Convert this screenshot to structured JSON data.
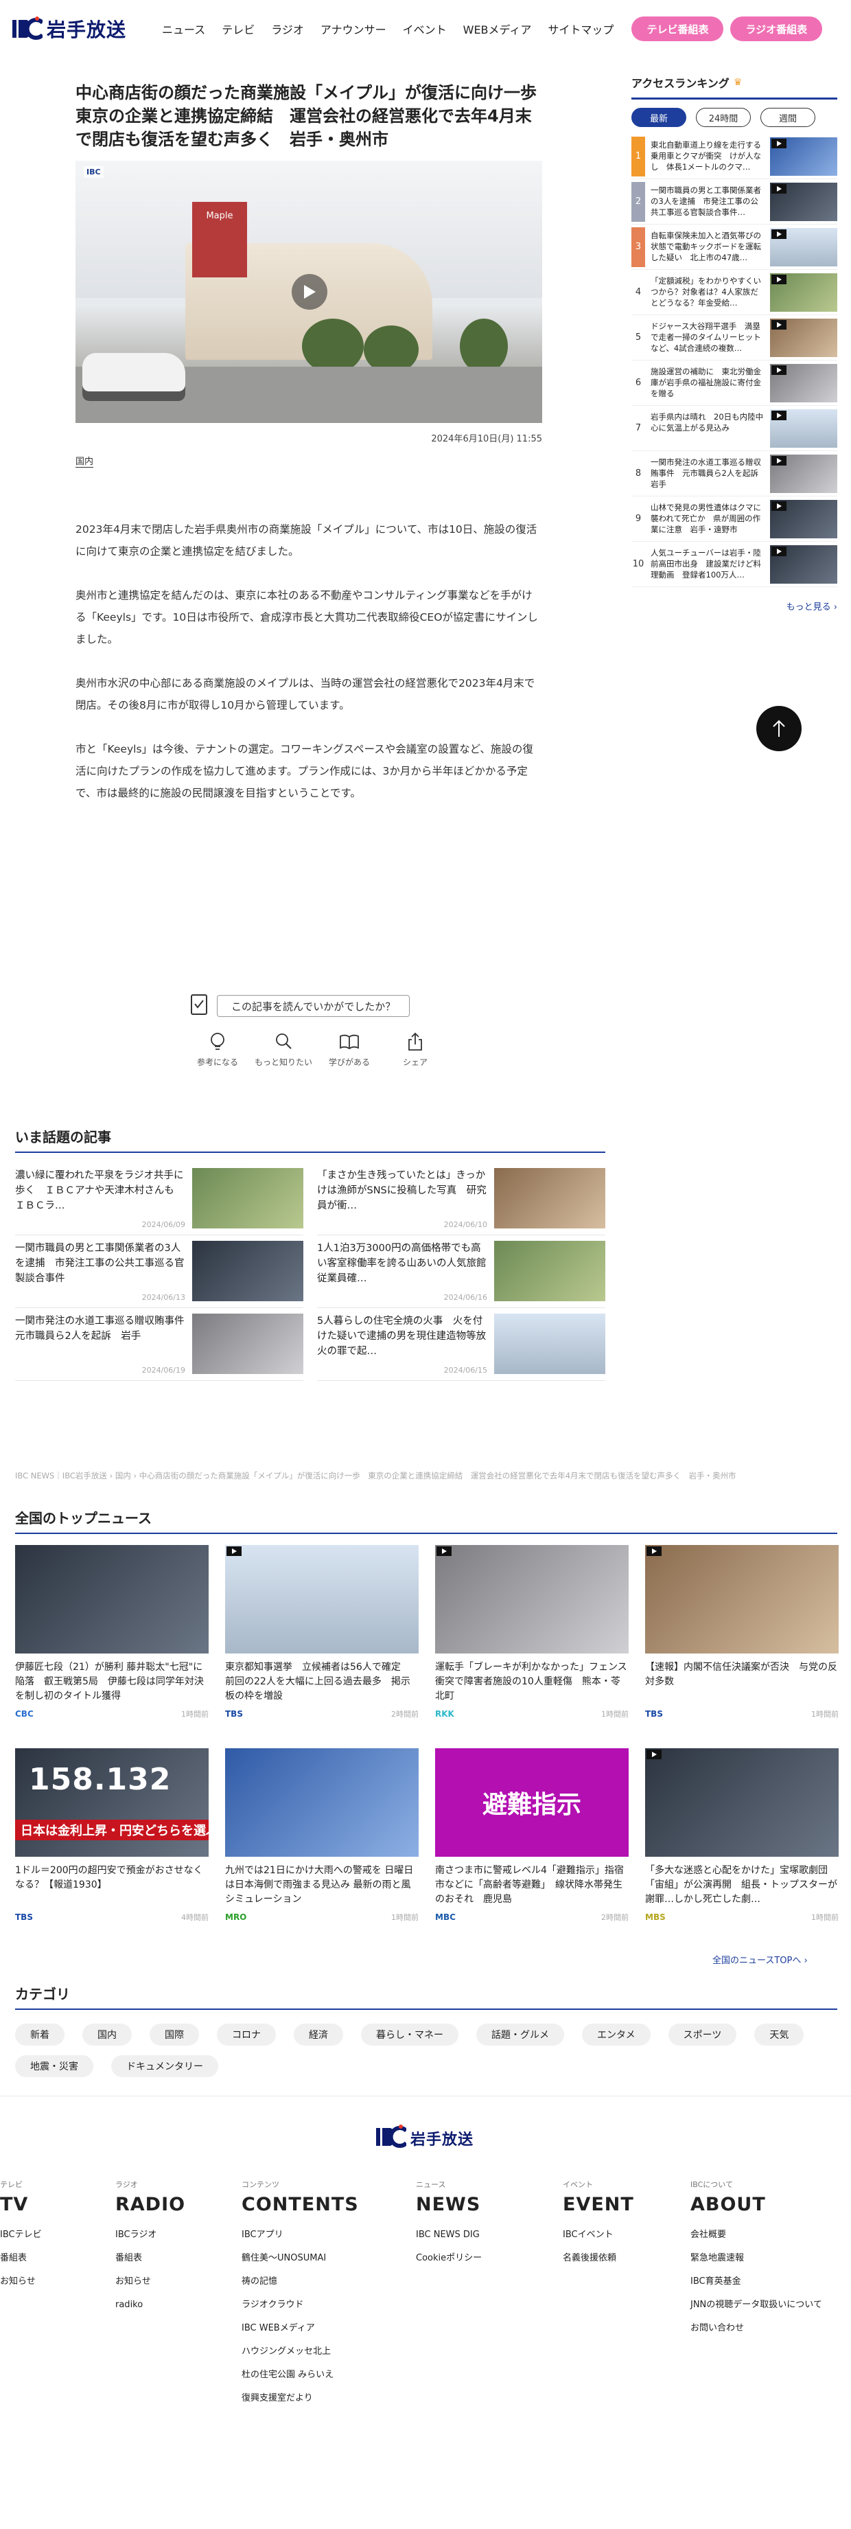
{
  "header": {
    "logo_text": "岩手放送",
    "nav": [
      "ニュース",
      "テレビ",
      "ラジオ",
      "アナウンサー",
      "イベント",
      "WEBメディア",
      "サイトマップ"
    ],
    "tv_schedule": "テレビ番組表",
    "radio_schedule": "ラジオ番組表"
  },
  "article": {
    "title": "中心商店街の顔だった商業施設「メイプル」が復活に向け一歩　東京の企業と連携協定締結　運営会社の経営悪化で去年4月末で閉店も復活を望む声多く　岩手・奥州市",
    "video_logo": "IBC",
    "video_sign": "Maple",
    "date": "2024年6月10日(月) 11:55",
    "category": "国内",
    "paragraphs": [
      "2023年4月末で閉店した岩手県奥州市の商業施設「メイプル」について、市は10日、施設の復活に向けて東京の企業と連携協定を結びました。",
      "奥州市と連携協定を結んだのは、東京に本社のある不動産やコンサルティング事業などを手がける「Keeyls」です。10日は市役所で、倉成淳市長と大貫功二代表取締役CEOが協定書にサインしました。",
      "奥州市水沢の中心部にある商業施設のメイプルは、当時の運営会社の経営悪化で2023年4月末で閉店。その後8月に市が取得し10月から管理しています。",
      "市と「Keeyls」は今後、テナントの選定。コワーキングスペースや会議室の設置など、施設の復活に向けたプランの作成を協力して進めます。プラン作成には、3か月から半年ほどかかる予定で、市は最終的に施設の民間譲渡を目指すということです。"
    ]
  },
  "feedback": {
    "question": "この記事を読んでいかがでしたか？",
    "reactions": [
      "参考になる",
      "もっと知りたい",
      "学びがある",
      "シェア"
    ]
  },
  "sidebar": {
    "title": "アクセスランキング",
    "tabs": [
      "最新",
      "24時間",
      "週間"
    ],
    "ranking": [
      {
        "rank": "1",
        "text": "東北自動車道上り線を走行する乗用車とクマが衝突　けが人なし　体長1メートルのクマ…"
      },
      {
        "rank": "2",
        "text": "一関市職員の男と工事関係業者の3人を逮捕　市発注工事の公共工事巡る官製談合事件…"
      },
      {
        "rank": "3",
        "text": "自転車保険未加入と酒気帯びの状態で電動キックボードを運転した疑い　北上市の47歳…"
      },
      {
        "rank": "4",
        "text": "「定額減税」をわかりやすくいつから？対象者は？4人家族だとどうなる？年金受給…"
      },
      {
        "rank": "5",
        "text": "ドジャース大谷翔平選手　満塁で走者一掃のタイムリーヒットなど、4試合連続の複数…"
      },
      {
        "rank": "6",
        "text": "施設運営の補助に　東北労働金庫が岩手県の福祉施設に寄付金を贈る"
      },
      {
        "rank": "7",
        "text": "岩手県内は晴れ　20日も内陸中心に気温上がる見込み"
      },
      {
        "rank": "8",
        "text": "一関市発注の水道工事巡る贈収賄事件　元市職員ら2人を起訴　岩手"
      },
      {
        "rank": "9",
        "text": "山林で発見の男性遺体はクマに襲われて死亡か　県が周囲の作業に注意　岩手・遠野市"
      },
      {
        "rank": "10",
        "text": "人気ユーチューバーは岩手・陸前高田市出身　建設業だけど料理動画　登録者100万人…"
      }
    ],
    "more": "もっと見る ›"
  },
  "hot": {
    "title": "いま話題の記事",
    "items": [
      {
        "title": "濃い緑に覆われた平泉をラジオ共手に歩く　ＩＢＣアナや天津木村さんも　ＩＢＣラ…",
        "date": "2024/06/09"
      },
      {
        "title": "「まさか生き残っていたとは」きっかけは漁師がSNSに投稿した写真　研究員が衝…",
        "date": "2024/06/10"
      },
      {
        "title": "一関市職員の男と工事関係業者の3人を逮捕　市発注工事の公共工事巡る官製談合事件",
        "date": "2024/06/13"
      },
      {
        "title": "1人1泊3万3000円の高価格帯でも高い客室稼働率を誇る山あいの人気旅館　従業員確…",
        "date": "2024/06/16"
      },
      {
        "title": "一関市発注の水道工事巡る贈収賄事件　元市職員ら2人を起訴　岩手",
        "date": "2024/06/19"
      },
      {
        "title": "5人暮らしの住宅全焼の火事　火を付けた疑いで逮捕の男を現住建造物等放火の罪で起…",
        "date": "2024/06/15"
      }
    ]
  },
  "breadcrumb": "IBC NEWS｜IBC岩手放送 › 国内 › 中心商店街の顔だった商業施設「メイプル」が復活に向け一歩　東京の企業と連携協定締結　運営会社の経営悪化で去年4月末で閉店も復活を望む声多く　岩手・奥州市",
  "topnews": {
    "title": "全国のトップニュース",
    "items": [
      {
        "title": "伊藤匠七段（21）が勝利 藤井聡太\"七冠\"に陥落　叡王戦第5局　伊藤七段は同学年対決を制し初のタイトル獲得",
        "source": "CBC",
        "time": "1時間前",
        "src_color": "#2a6fd1"
      },
      {
        "title": "東京都知事選挙　立候補者は56人で確定　前回の22人を大幅に上回る過去最多　掲示板の枠を増設",
        "source": "TBS",
        "time": "2時間前",
        "src_color": "#1a4aa6"
      },
      {
        "title": "運転手「ブレーキが利かなかった」フェンス衝突で障害者施設の10人重軽傷　熊本・苓北町",
        "source": "RKK",
        "time": "1時間前",
        "src_color": "#2db8c9"
      },
      {
        "title": "【速報】内閣不信任決議案が否決　与党の反対多数",
        "source": "TBS",
        "time": "1時間前",
        "src_color": "#1a4aa6"
      },
      {
        "title": "1ドル＝200円の超円安で預金がおさせなくなる？【報道1930】",
        "source": "TBS",
        "time": "4時間前",
        "src_color": "#1a4aa6"
      },
      {
        "title": "九州では21日にかけ大雨への警戒を 日曜日は日本海側で雨強まる見込み 最新の雨と風シミュレーション",
        "source": "MRO",
        "time": "1時間前",
        "src_color": "#2ba02b"
      },
      {
        "title": "南さつま市に警戒レベル4「避難指示」指宿市などに「高齢者等避難」　線状降水帯発生のおそれ　鹿児島",
        "source": "MBC",
        "time": "2時間前",
        "src_color": "#1b5aa9"
      },
      {
        "title": "「多大な迷惑と心配をかけた」宝塚歌劇団「宙組」が公演再開　組長・トップスターが謝罪…しかし死亡した劇…",
        "source": "MBS",
        "time": "1時間前",
        "src_color": "#b5a51e"
      }
    ],
    "price_text": "158.132",
    "strip_text": "日本は金利上昇・円安どちらを選ぶのか",
    "evac_text": "避難指示",
    "more": "全国のニュースTOPへ ›"
  },
  "category": {
    "title": "カテゴリ",
    "items": [
      "新着",
      "国内",
      "国際",
      "コロナ",
      "経済",
      "暮らし・マネー",
      "話題・グルメ",
      "エンタメ",
      "スポーツ",
      "天気",
      "地震・災害",
      "ドキュメンタリー"
    ]
  },
  "footer": {
    "logo_text": "岩手放送",
    "cols": [
      {
        "small": "テレビ",
        "head": "TV",
        "links": [
          "IBCテレビ",
          "番組表",
          "お知らせ"
        ]
      },
      {
        "small": "ラジオ",
        "head": "RADIO",
        "links": [
          "IBCラジオ",
          "番組表",
          "お知らせ",
          "radiko"
        ]
      },
      {
        "small": "コンテンツ",
        "head": "CONTENTS",
        "links": [
          "IBCアプリ",
          "鶴住美〜UNOSUMAI",
          "祷の記憶",
          "ラジオクラウド",
          "IBC WEBメディア",
          "ハウジングメッセ北上",
          "杜の住宅公園 みらいえ",
          "復興支援室だより"
        ]
      },
      {
        "small": "ニュース",
        "head": "NEWS",
        "links": [
          "IBC NEWS DIG",
          "Cookieポリシー"
        ]
      },
      {
        "small": "イベント",
        "head": "EVENT",
        "links": [
          "IBCイベント",
          "名義後援依頼"
        ]
      },
      {
        "small": "IBCについて",
        "head": "ABOUT",
        "links": [
          "会社概要",
          "緊急地震速報",
          "IBC育英基金",
          "JNNの視聴データ取扱いについて",
          "お問い合わせ"
        ]
      }
    ]
  }
}
